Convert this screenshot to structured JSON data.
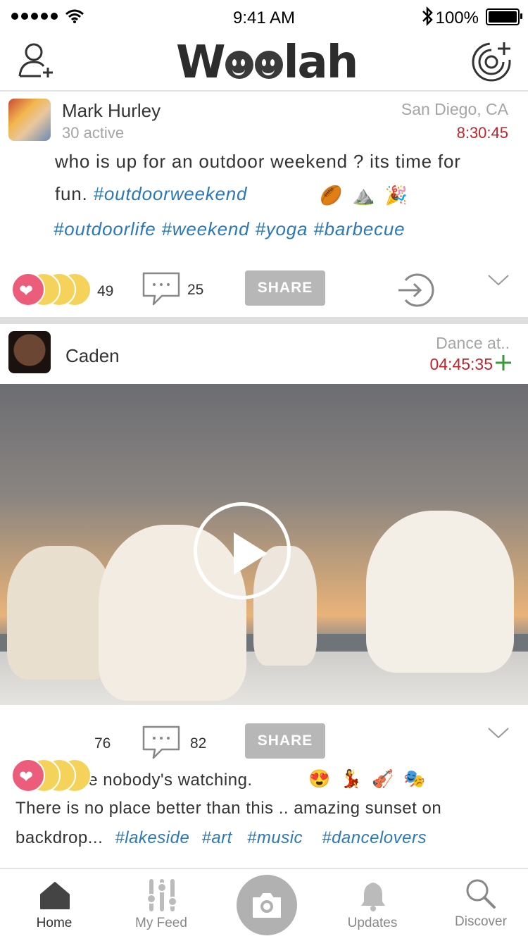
{
  "status_bar": {
    "time": "9:41 AM",
    "battery": "100%"
  },
  "header": {
    "logo": "Woolah"
  },
  "posts": [
    {
      "user": "Mark Hurley",
      "subtitle": "30 active",
      "location": "San Diego, CA",
      "timer": "8:30:45",
      "text_line1": "who is up for an outdoor weekend ? its time for",
      "text_line2_prefix": "fun. ",
      "text_line2_tag": "#outdoorweekend",
      "emojis": [
        "🏉",
        "⛰️",
        "🎉"
      ],
      "tags": "#outdoorlife #weekend #yoga #barbecue",
      "reactions_count": "49",
      "comments_count": "25",
      "share_label": "SHARE"
    },
    {
      "user": "Caden",
      "location": "Dance at..",
      "timer": "04:45:35",
      "reactions_count": "76",
      "comments_count": "82",
      "share_label": "SHARE",
      "caption_line1": "Dance like nobody's watching.",
      "emojis": [
        "😍",
        "💃",
        "🎻",
        "🎭"
      ],
      "caption_line2": "There is no place better than this .. amazing sunset on",
      "caption_line3": "backdrop...",
      "tags": [
        "#lakeside",
        "#art",
        "#music",
        "#dancelovers"
      ]
    }
  ],
  "nav": {
    "items": [
      {
        "label": "Home",
        "icon": "home-icon",
        "active": true
      },
      {
        "label": "My Feed",
        "icon": "sliders-icon",
        "active": false
      },
      {
        "label": "",
        "icon": "camera-icon",
        "active": false
      },
      {
        "label": "Updates",
        "icon": "bell-icon",
        "active": false
      },
      {
        "label": "Discover",
        "icon": "search-icon",
        "active": false
      }
    ]
  },
  "colors": {
    "accent_red": "#c2242a",
    "tag_blue": "#2b78b8",
    "plus_green": "#3a9a3a",
    "heart_pink": "#ec5c7b"
  }
}
